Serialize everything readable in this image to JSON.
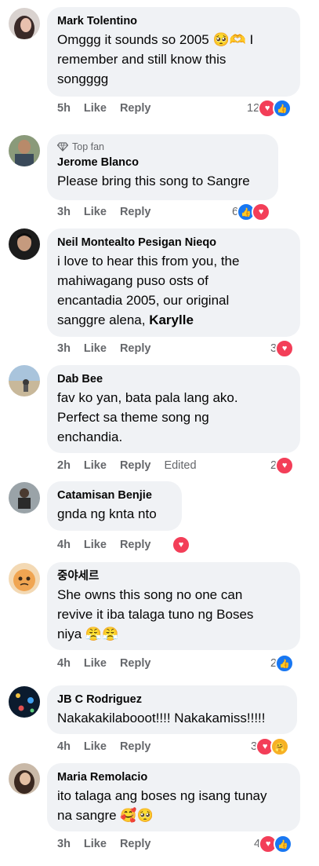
{
  "comments": [
    {
      "name": "Mark Tolentino",
      "lines": [
        "Omggg it sounds so 2005 🥺🫶 I",
        "remember and still know this",
        "songggg"
      ],
      "time": "5h",
      "like": "Like",
      "reply": "Reply",
      "count": "12"
    },
    {
      "badge": "Top fan",
      "name": "Jerome Blanco",
      "lines": [
        "Please bring this song to Sangre"
      ],
      "time": "3h",
      "like": "Like",
      "reply": "Reply",
      "count": "6"
    },
    {
      "name": "Neil Montealto Pesigan Nieqo",
      "lines": [
        "i love to hear this from you, the",
        "mahiwagang puso osts of",
        "encantadia 2005, our original"
      ],
      "line4_text": "sanggre alena, ",
      "line4_bold": "Karylle",
      "time": "3h",
      "like": "Like",
      "reply": "Reply",
      "count": "3"
    },
    {
      "name": "Dab Bee",
      "lines": [
        "fav ko yan, bata pala lang ako.",
        "Perfect sa theme song ng",
        "enchandia."
      ],
      "time": "2h",
      "like": "Like",
      "reply": "Reply",
      "edited": "Edited",
      "count": "2"
    },
    {
      "name": "Catamisan Benjie",
      "lines": [
        "gnda ng knta nto"
      ],
      "time": "4h",
      "like": "Like",
      "reply": "Reply"
    },
    {
      "name": "중야세르",
      "lines": [
        "She owns this song no one can",
        "revive it iba talaga tuno ng Boses",
        "niya 😤😤"
      ],
      "time": "4h",
      "like": "Like",
      "reply": "Reply",
      "count": "2"
    },
    {
      "name": "JB C Rodriguez",
      "lines": [
        "Nakakakilabooot!!!! Nakakamiss!!!!!"
      ],
      "time": "4h",
      "like": "Like",
      "reply": "Reply",
      "count": "3"
    },
    {
      "name": "Maria Remolacio",
      "lines": [
        "ito talaga ang boses ng isang tunay",
        "na sangre 🥰🥺"
      ],
      "time": "3h",
      "like": "Like",
      "reply": "Reply",
      "count": "4"
    }
  ],
  "icons": {
    "heart": "heart-icon",
    "like": "thumbs-up-icon",
    "care": "care-icon",
    "top_fan": "diamond-icon"
  },
  "colors": {
    "like_blue": "#1877f2",
    "love_red": "#f33e58",
    "bubble": "#f0f2f5",
    "meta_gray": "#65676b"
  }
}
